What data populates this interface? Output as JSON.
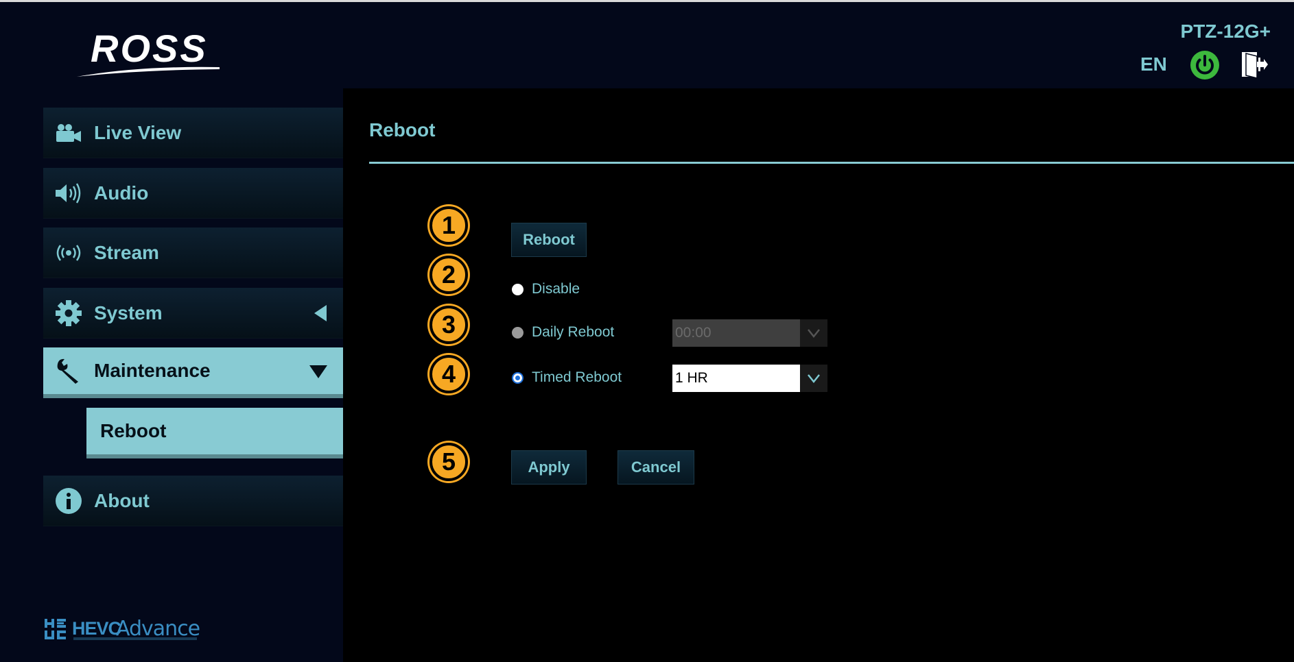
{
  "header": {
    "brand": "ROSS",
    "model": "PTZ-12G+",
    "language": "EN"
  },
  "sidebar": {
    "items": [
      {
        "label": "Live View",
        "icon": "video-camera-icon"
      },
      {
        "label": "Audio",
        "icon": "speaker-icon"
      },
      {
        "label": "Stream",
        "icon": "broadcast-icon"
      },
      {
        "label": "System",
        "icon": "gear-icon"
      },
      {
        "label": "Maintenance",
        "icon": "wrench-icon"
      },
      {
        "label": "About",
        "icon": "info-icon"
      }
    ],
    "sub_item": "Reboot",
    "footer_logo": {
      "part1": "HEVC",
      "part2": "Advance"
    }
  },
  "main": {
    "title": "Reboot",
    "steps": [
      "1",
      "2",
      "3",
      "4",
      "5"
    ],
    "reboot_button": "Reboot",
    "options": {
      "disable": "Disable",
      "daily": "Daily Reboot",
      "timed": "Timed Reboot"
    },
    "daily_time": "00:00",
    "timed_interval": "1 HR",
    "apply_button": "Apply",
    "cancel_button": "Cancel"
  },
  "colors": {
    "accent": "#7fc9d1",
    "active_nav": "#88cbd3",
    "step_badge": "#f7a823",
    "power": "#3db83d"
  }
}
